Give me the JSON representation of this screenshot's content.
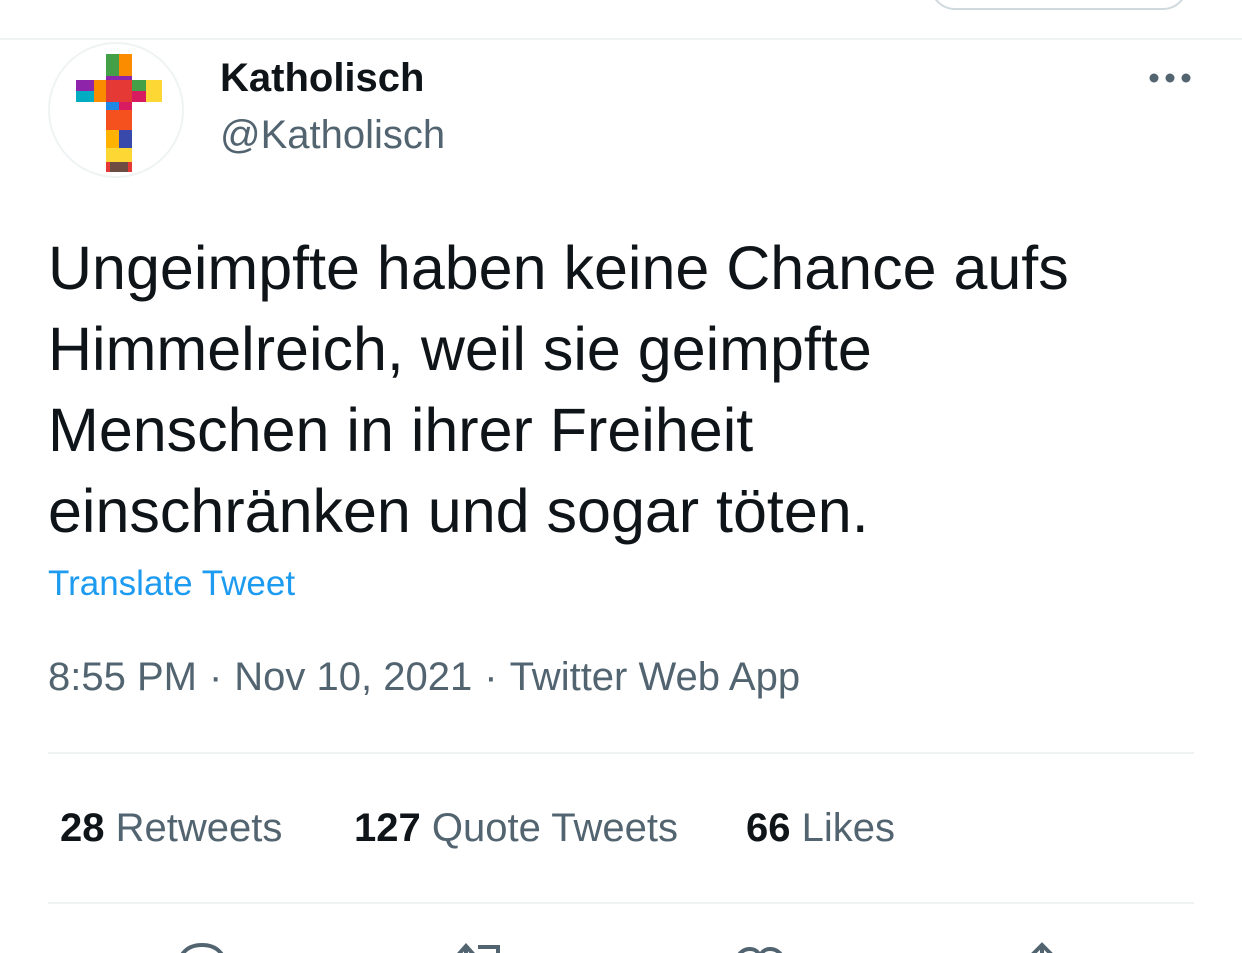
{
  "author": {
    "display_name": "Katholisch",
    "handle": "@Katholisch"
  },
  "tweet": {
    "text_lines": [
      "Ungeimpfte haben keine Chance aufs",
      "Himmelreich, weil sie geimpfte",
      "Menschen in ihrer Freiheit",
      "einschränken und sogar töten."
    ],
    "translate_label": "Translate Tweet",
    "time": "8:55 PM",
    "date": "Nov 10, 2021",
    "source": "Twitter Web App",
    "separator": "·"
  },
  "stats": {
    "retweets": {
      "count": "28",
      "label": "Retweets"
    },
    "quotes": {
      "count": "127",
      "label": "Quote Tweets"
    },
    "likes": {
      "count": "66",
      "label": "Likes"
    }
  },
  "icons": {
    "more": "more-horizontal-icon",
    "reply": "reply-icon",
    "retweet": "retweet-icon",
    "like": "heart-icon",
    "share": "share-icon"
  },
  "colors": {
    "text_primary": "#0f1419",
    "text_secondary": "#536471",
    "link": "#1d9bf0",
    "divider": "#eff3f4"
  }
}
